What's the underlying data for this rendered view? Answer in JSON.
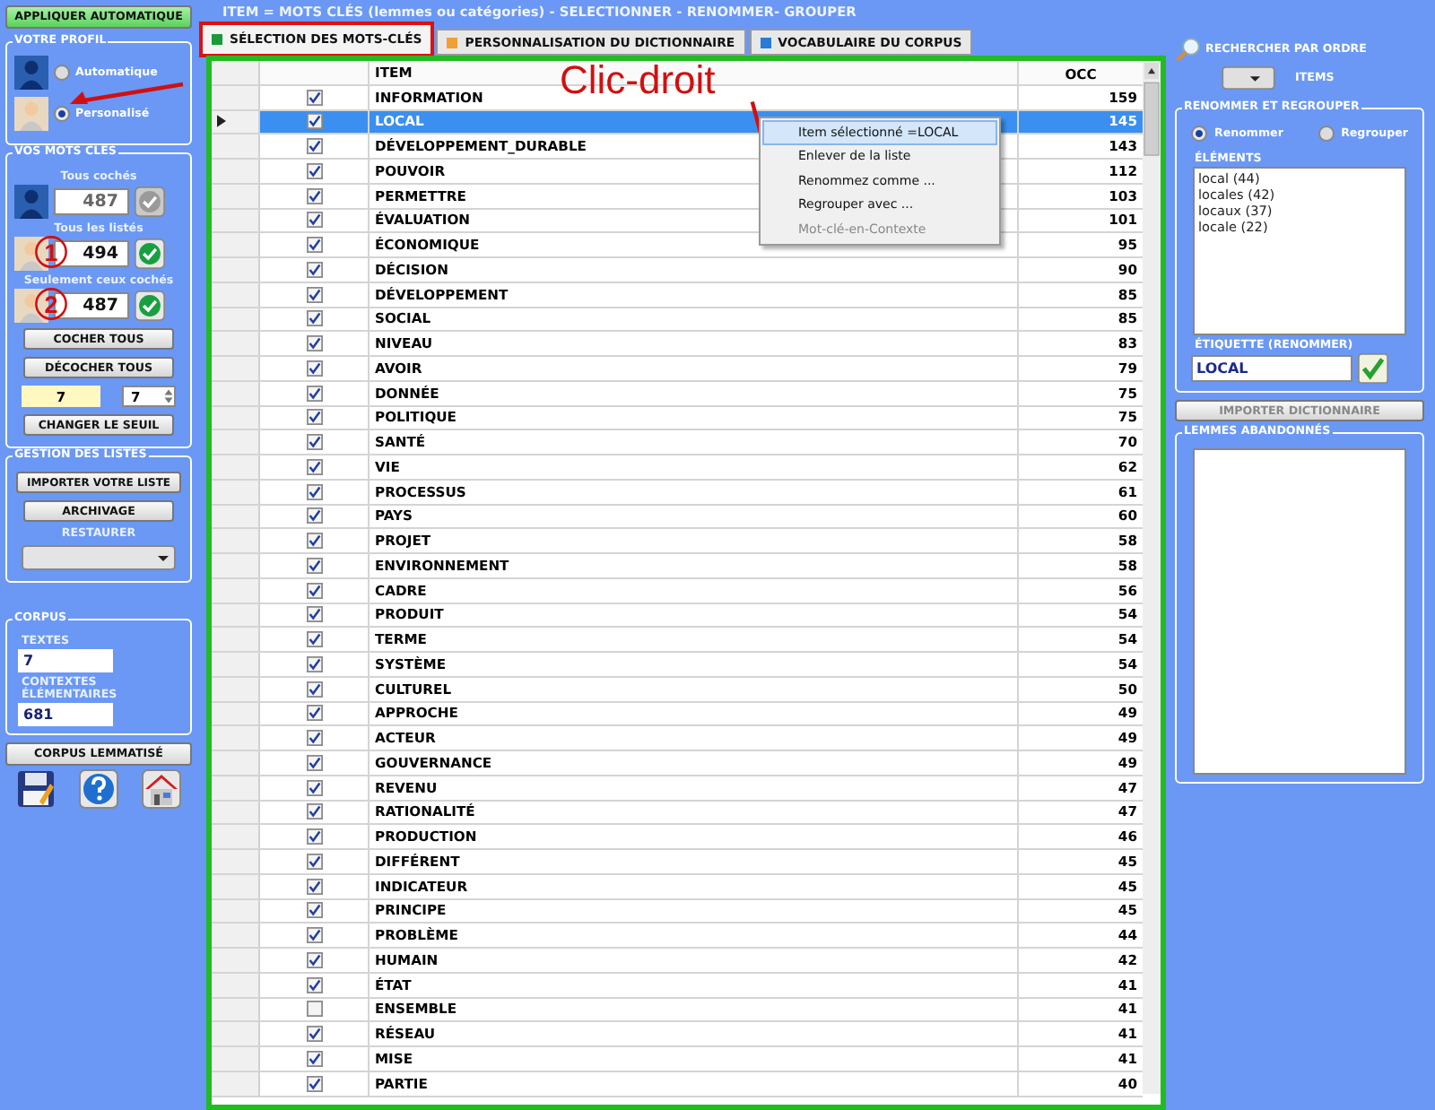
{
  "title": "ITEM  = MOTS CLÉS (lemmes ou catégories) - SELECTIONNER - RENOMMER- GROUPER",
  "left": {
    "apply_button": "APPLIQUER AUTOMATIQUE",
    "profile": {
      "title": "VOTRE PROFIL",
      "options": [
        {
          "label": "Automatique",
          "selected": false,
          "kind": "silhouette"
        },
        {
          "label": "Personalisé",
          "selected": true,
          "kind": "face"
        }
      ]
    },
    "keywords": {
      "title": "VOS MOTS CLÉS",
      "counters": [
        {
          "label": "Tous cochés",
          "value": "487",
          "kind": "silhouette",
          "disabled": true
        },
        {
          "label": "Tous les listés",
          "value": "494",
          "kind": "face",
          "disabled": false
        },
        {
          "label": "Seulement ceux cochés",
          "value": "487",
          "kind": "face",
          "disabled": false
        }
      ],
      "check_all": "COCHER TOUS",
      "uncheck_all": "DÉCOCHER TOUS",
      "threshold": "7",
      "threshold_spin": "7",
      "change_threshold": "CHANGER LE SEUIL"
    },
    "lists": {
      "title": "GESTION DES LISTES",
      "import": "IMPORTER VOTRE LISTE",
      "archive": "ARCHIVAGE",
      "restore": "RESTAURER"
    },
    "corpus": {
      "title": "CORPUS",
      "texts_label": "TEXTES",
      "texts": "7",
      "contexts_label": "CONTEXTES ÉLÉMENTAIRES",
      "contexts": "681"
    },
    "lemmatized": "CORPUS LEMMATISÉ"
  },
  "tabs": [
    {
      "label": "SÉLECTION DES MOTS-CLÉS",
      "selected": true,
      "color": "#1a9a3a"
    },
    {
      "label": "PERSONNALISATION DU DICTIONNAIRE",
      "selected": false,
      "color": "#f0a030"
    },
    {
      "label": "VOCABULAIRE DU CORPUS",
      "selected": false,
      "color": "#2a7ad8"
    }
  ],
  "table": {
    "columns": [
      "ITEM",
      "OCC"
    ],
    "rows": [
      {
        "item": "INFORMATION",
        "occ": "159",
        "checked": true,
        "selected": false
      },
      {
        "item": "LOCAL",
        "occ": "145",
        "checked": true,
        "selected": true
      },
      {
        "item": "DÉVELOPPEMENT_DURABLE",
        "occ": "143",
        "checked": true,
        "selected": false
      },
      {
        "item": "POUVOIR",
        "occ": "112",
        "checked": true,
        "selected": false
      },
      {
        "item": "PERMETTRE",
        "occ": "103",
        "checked": true,
        "selected": false
      },
      {
        "item": "ÉVALUATION",
        "occ": "101",
        "checked": true,
        "selected": false
      },
      {
        "item": "ÉCONOMIQUE",
        "occ": "95",
        "checked": true,
        "selected": false
      },
      {
        "item": "DÉCISION",
        "occ": "90",
        "checked": true,
        "selected": false
      },
      {
        "item": "DÉVELOPPEMENT",
        "occ": "85",
        "checked": true,
        "selected": false
      },
      {
        "item": "SOCIAL",
        "occ": "85",
        "checked": true,
        "selected": false
      },
      {
        "item": "NIVEAU",
        "occ": "83",
        "checked": true,
        "selected": false
      },
      {
        "item": "AVOIR",
        "occ": "79",
        "checked": true,
        "selected": false
      },
      {
        "item": "DONNÉE",
        "occ": "75",
        "checked": true,
        "selected": false
      },
      {
        "item": "POLITIQUE",
        "occ": "75",
        "checked": true,
        "selected": false
      },
      {
        "item": "SANTÉ",
        "occ": "70",
        "checked": true,
        "selected": false
      },
      {
        "item": "VIE",
        "occ": "62",
        "checked": true,
        "selected": false
      },
      {
        "item": "PROCESSUS",
        "occ": "61",
        "checked": true,
        "selected": false
      },
      {
        "item": "PAYS",
        "occ": "60",
        "checked": true,
        "selected": false
      },
      {
        "item": "PROJET",
        "occ": "58",
        "checked": true,
        "selected": false
      },
      {
        "item": "ENVIRONNEMENT",
        "occ": "58",
        "checked": true,
        "selected": false
      },
      {
        "item": "CADRE",
        "occ": "56",
        "checked": true,
        "selected": false
      },
      {
        "item": "PRODUIT",
        "occ": "54",
        "checked": true,
        "selected": false
      },
      {
        "item": "TERME",
        "occ": "54",
        "checked": true,
        "selected": false
      },
      {
        "item": "SYSTÈME",
        "occ": "54",
        "checked": true,
        "selected": false
      },
      {
        "item": "CULTUREL",
        "occ": "50",
        "checked": true,
        "selected": false
      },
      {
        "item": "APPROCHE",
        "occ": "49",
        "checked": true,
        "selected": false
      },
      {
        "item": "ACTEUR",
        "occ": "49",
        "checked": true,
        "selected": false
      },
      {
        "item": "GOUVERNANCE",
        "occ": "49",
        "checked": true,
        "selected": false
      },
      {
        "item": "REVENU",
        "occ": "47",
        "checked": true,
        "selected": false
      },
      {
        "item": "RATIONALITÉ",
        "occ": "47",
        "checked": true,
        "selected": false
      },
      {
        "item": "PRODUCTION",
        "occ": "46",
        "checked": true,
        "selected": false
      },
      {
        "item": "DIFFÉRENT",
        "occ": "45",
        "checked": true,
        "selected": false
      },
      {
        "item": "INDICATEUR",
        "occ": "45",
        "checked": true,
        "selected": false
      },
      {
        "item": "PRINCIPE",
        "occ": "45",
        "checked": true,
        "selected": false
      },
      {
        "item": "PROBLÈME",
        "occ": "44",
        "checked": true,
        "selected": false
      },
      {
        "item": "HUMAIN",
        "occ": "42",
        "checked": true,
        "selected": false
      },
      {
        "item": "ÉTAT",
        "occ": "41",
        "checked": true,
        "selected": false
      },
      {
        "item": "ENSEMBLE",
        "occ": "41",
        "checked": false,
        "selected": false
      },
      {
        "item": "RÉSEAU",
        "occ": "41",
        "checked": true,
        "selected": false
      },
      {
        "item": "MISE",
        "occ": "41",
        "checked": true,
        "selected": false
      },
      {
        "item": "PARTIE",
        "occ": "40",
        "checked": true,
        "selected": false
      }
    ]
  },
  "context_menu": {
    "items": [
      {
        "label": "Item sélectionné =LOCAL",
        "selected": true,
        "disabled": false
      },
      {
        "label": "Enlever de la liste",
        "selected": false,
        "disabled": false
      },
      {
        "label": "Renommez comme ...",
        "selected": false,
        "disabled": false
      },
      {
        "label": "Regrouper avec ...",
        "selected": false,
        "disabled": false
      },
      {
        "label": "Mot-clé-en-Contexte",
        "selected": false,
        "disabled": true
      }
    ]
  },
  "annotations": {
    "right_click": "Clic-droit",
    "markers": [
      "1",
      "2"
    ]
  },
  "right": {
    "search": "RECHERCHER PAR ORDRE",
    "items_label": "ITEMS",
    "rename_group": {
      "title": "RENOMMER ET REGROUPER",
      "options": [
        {
          "label": "Renommer",
          "selected": true
        },
        {
          "label": "Regrouper",
          "selected": false
        }
      ],
      "elements_label": "ÉLÉMENTS",
      "elements": [
        "local (44)",
        "locales (42)",
        "locaux (37)",
        "locale (22)"
      ],
      "tag_label": "ÉTIQUETTE (RENOMMER)",
      "tag": "LOCAL"
    },
    "import_dictionary": "IMPORTER DICTIONNAIRE",
    "abandoned": {
      "title": "LEMMES ABANDONNÉS"
    }
  }
}
